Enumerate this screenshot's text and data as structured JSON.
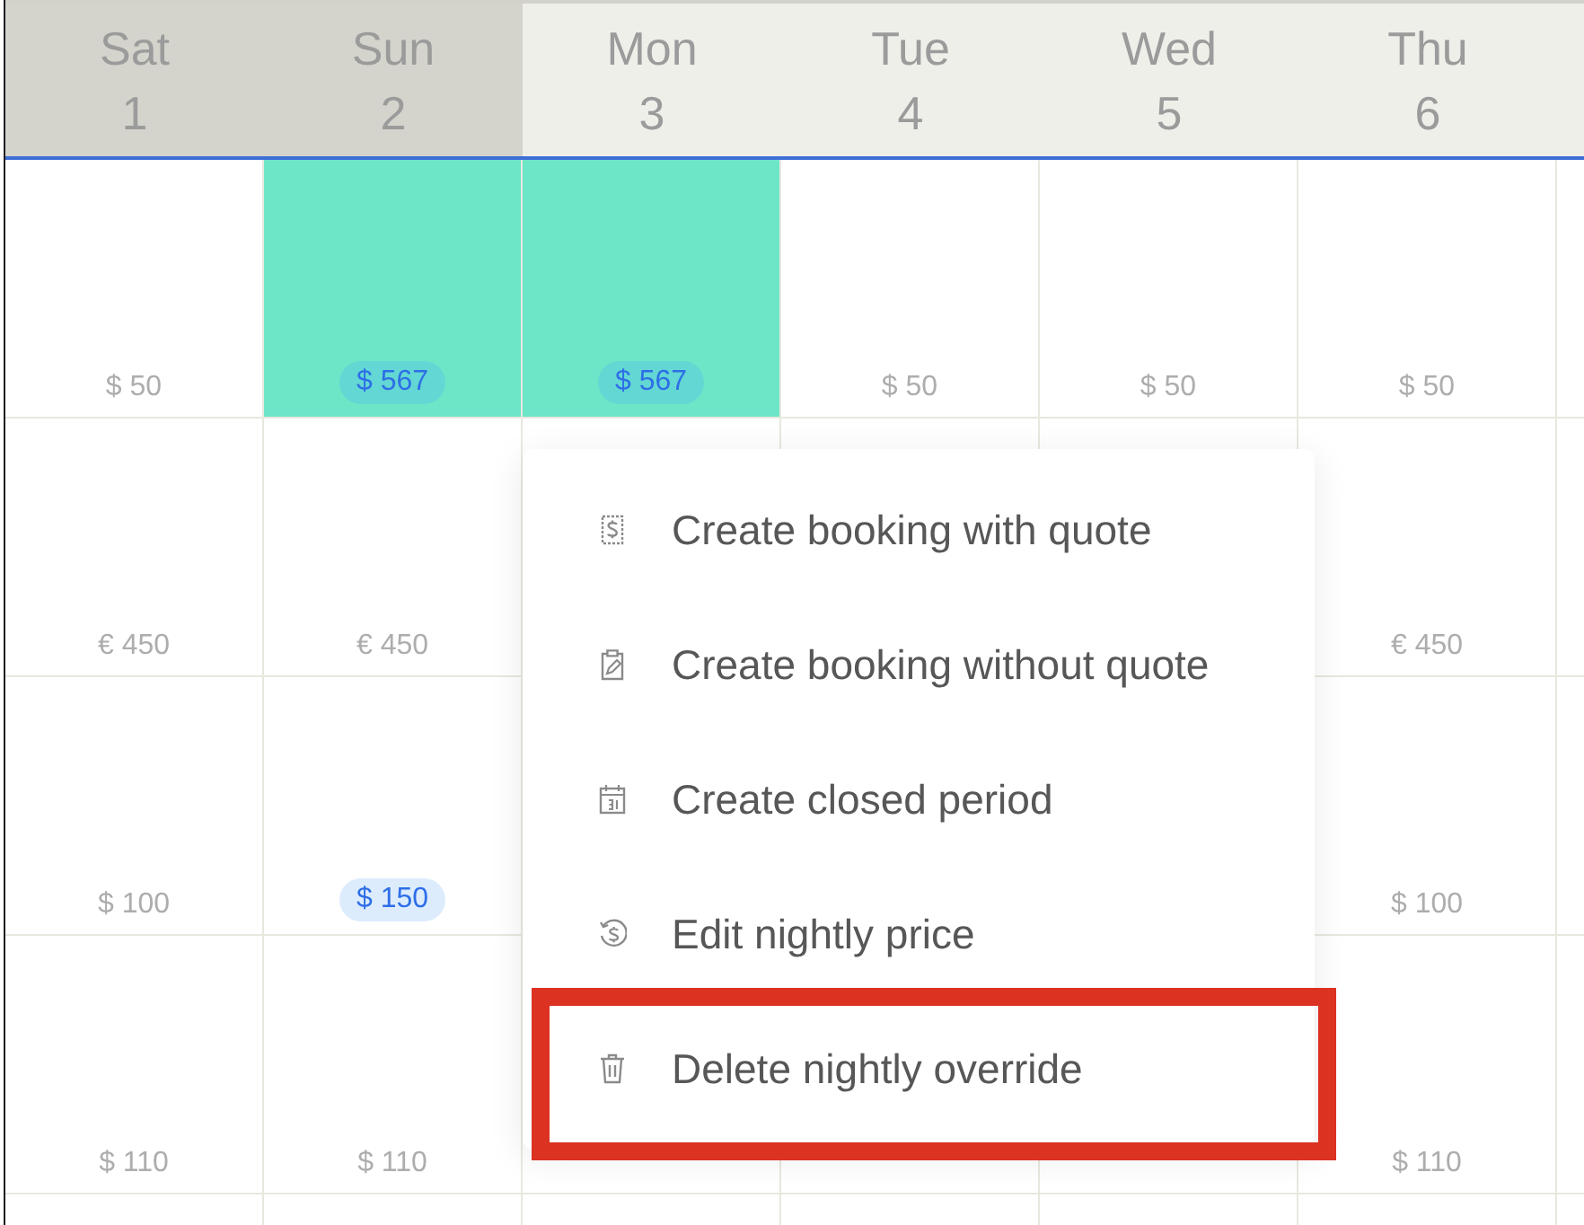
{
  "header": {
    "days": [
      {
        "name": "Sat",
        "date": "1",
        "weekend": true
      },
      {
        "name": "Sun",
        "date": "2",
        "weekend": true
      },
      {
        "name": "Mon",
        "date": "3",
        "weekend": false
      },
      {
        "name": "Tue",
        "date": "4",
        "weekend": false
      },
      {
        "name": "Wed",
        "date": "5",
        "weekend": false
      },
      {
        "name": "Thu",
        "date": "6",
        "weekend": false
      }
    ]
  },
  "rows": [
    {
      "cells": [
        {
          "price": "$ 50",
          "override": false,
          "selected": false
        },
        {
          "price": "$ 567",
          "override": true,
          "selected": true
        },
        {
          "price": "$ 567",
          "override": true,
          "selected": true
        },
        {
          "price": "$ 50",
          "override": false,
          "selected": false
        },
        {
          "price": "$ 50",
          "override": false,
          "selected": false
        },
        {
          "price": "$ 50",
          "override": false,
          "selected": false
        }
      ]
    },
    {
      "cells": [
        {
          "price": "€ 450",
          "override": false,
          "selected": false
        },
        {
          "price": "€ 450",
          "override": false,
          "selected": false
        },
        {
          "selected": false
        },
        {
          "selected": false
        },
        {
          "selected": false
        },
        {
          "price": "€ 450",
          "override": false,
          "selected": false
        }
      ]
    },
    {
      "cells": [
        {
          "price": "$ 100",
          "override": false,
          "selected": false
        },
        {
          "price": "$ 150",
          "override": true,
          "selected": false
        },
        null,
        null,
        null,
        {
          "price": "$ 100",
          "override": false,
          "selected": false
        }
      ]
    },
    {
      "cells": [
        {
          "price": "$ 110",
          "override": false,
          "selected": false
        },
        {
          "price": "$ 110",
          "override": false,
          "selected": false
        },
        {
          "selected": false
        },
        {
          "selected": false
        },
        {
          "selected": false
        },
        {
          "price": "$ 110",
          "override": false,
          "selected": false
        }
      ]
    }
  ],
  "context_menu": {
    "items": [
      {
        "kind": "quote",
        "label": "Create booking with quote",
        "highlighted": false
      },
      {
        "kind": "clipboard",
        "label": "Create booking without quote",
        "highlighted": false
      },
      {
        "kind": "calendar",
        "label": "Create closed period",
        "highlighted": false
      },
      {
        "kind": "price",
        "label": "Edit nightly price",
        "highlighted": false
      },
      {
        "kind": "trash",
        "label": "Delete nightly override",
        "highlighted": true
      }
    ]
  }
}
